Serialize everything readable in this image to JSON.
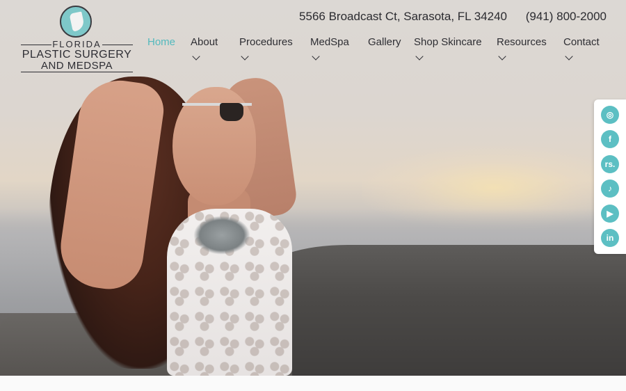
{
  "logo": {
    "line1": "FLORIDA",
    "line2": "PLASTIC SURGERY",
    "line3": "AND MEDSPA"
  },
  "contact": {
    "address": "5566 Broadcast Ct, Sarasota, FL 34240",
    "phone": "(941) 800-2000"
  },
  "nav": {
    "items": [
      {
        "label": "Home",
        "active": true,
        "dropdown": false
      },
      {
        "label": "About",
        "active": false,
        "dropdown": true
      },
      {
        "label": "Procedures",
        "active": false,
        "dropdown": true
      },
      {
        "label": "MedSpa",
        "active": false,
        "dropdown": true
      },
      {
        "label": "Gallery",
        "active": false,
        "dropdown": false
      },
      {
        "label": "Shop Skincare",
        "active": false,
        "dropdown": true
      },
      {
        "label": "Resources",
        "active": false,
        "dropdown": true
      },
      {
        "label": "Contact",
        "active": false,
        "dropdown": true
      }
    ]
  },
  "social": {
    "items": [
      {
        "icon": "instagram-icon",
        "glyph": "◎"
      },
      {
        "icon": "facebook-icon",
        "glyph": "f"
      },
      {
        "icon": "realself-icon",
        "glyph": "rs."
      },
      {
        "icon": "tiktok-icon",
        "glyph": "♪"
      },
      {
        "icon": "youtube-icon",
        "glyph": "▶"
      },
      {
        "icon": "linkedin-icon",
        "glyph": "in"
      }
    ]
  },
  "colors": {
    "accent": "#53b9bd",
    "text": "#2e2e33",
    "social": "#5cbfc3"
  }
}
